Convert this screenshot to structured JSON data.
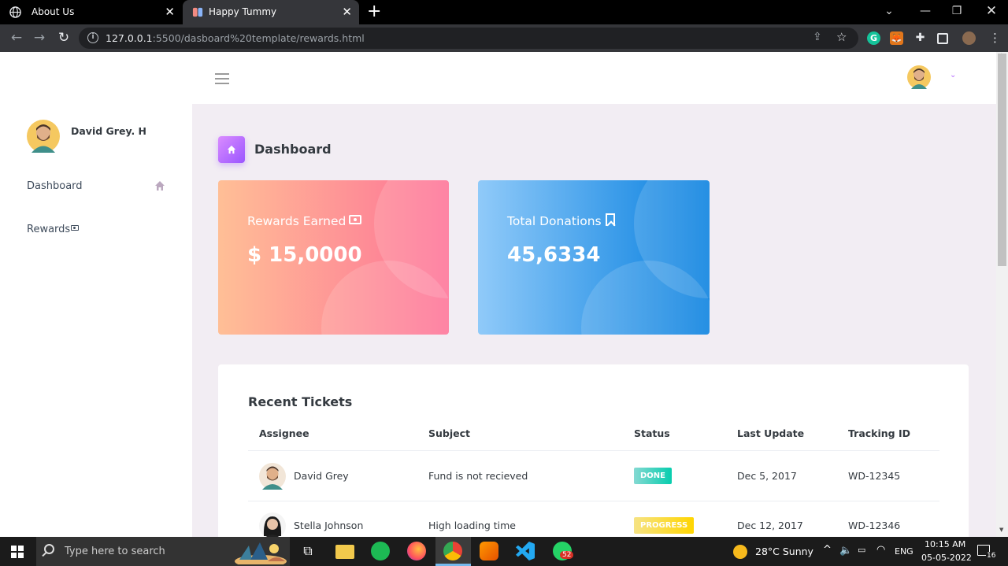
{
  "browser": {
    "tabs": [
      {
        "title": "About Us",
        "close": "✕"
      },
      {
        "title": "Happy Tummy",
        "close": "✕"
      }
    ],
    "new_tab": "+",
    "url_host": "127.0.0.1",
    "url_path": ":5500/dasboard%20template/rewards.html"
  },
  "sidebar": {
    "user_name": "David Grey. H",
    "items": [
      {
        "label": "Dashboard"
      },
      {
        "label": "Rewards"
      }
    ]
  },
  "page": {
    "title": "Dashboard"
  },
  "cards": [
    {
      "label": "Rewards Earned",
      "value": "$ 15,0000"
    },
    {
      "label": "Total Donations",
      "value": "45,6334"
    }
  ],
  "tickets": {
    "title": "Recent Tickets",
    "columns": [
      "Assignee",
      "Subject",
      "Status",
      "Last Update",
      "Tracking ID"
    ],
    "rows": [
      {
        "assignee": "David Grey",
        "subject": "Fund is not recieved",
        "status": "DONE",
        "last_update": "Dec 5, 2017",
        "tracking_id": "WD-12345"
      },
      {
        "assignee": "Stella Johnson",
        "subject": "High loading time",
        "status": "PROGRESS",
        "last_update": "Dec 12, 2017",
        "tracking_id": "WD-12346"
      }
    ]
  },
  "taskbar": {
    "search_placeholder": "Type here to search",
    "weather": "28°C  Sunny",
    "language": "ENG",
    "time": "10:15 AM",
    "date": "05-05-2022",
    "notification_count": "16",
    "whatsapp_badge": "52"
  },
  "colors": {
    "accent": "#b66dff",
    "card_red_from": "#ffbf96",
    "card_red_to": "#fe7096",
    "card_blue_from": "#90caf9",
    "card_blue_to": "#047edf",
    "done": "#1bcfb4",
    "progress": "#fed713"
  }
}
